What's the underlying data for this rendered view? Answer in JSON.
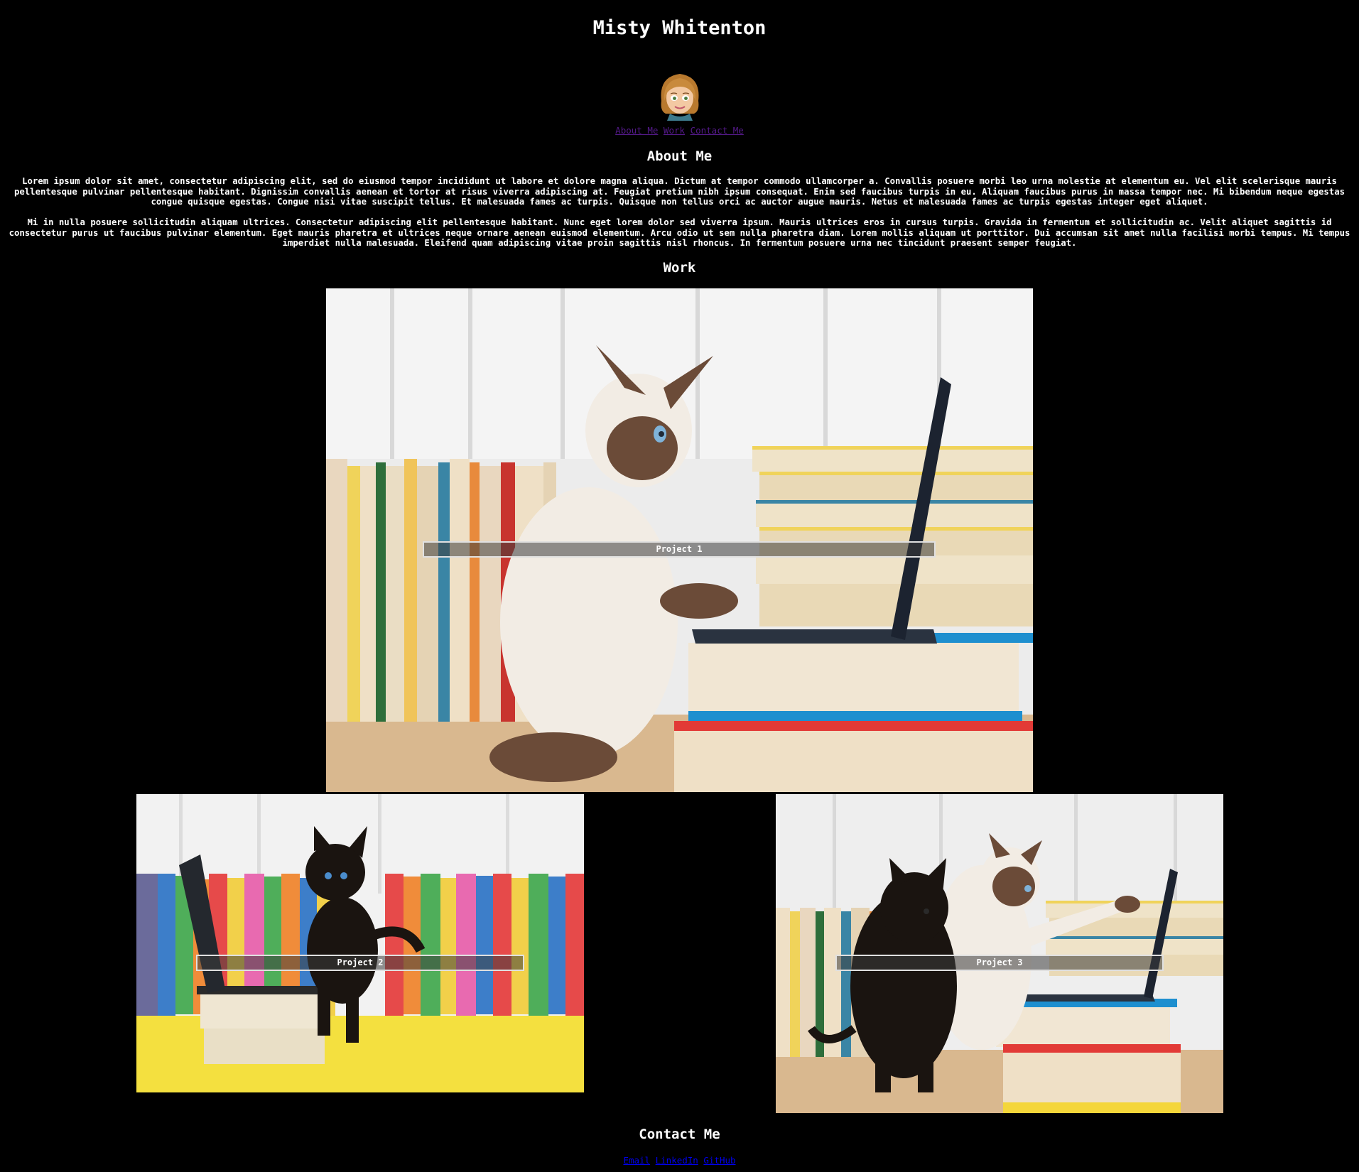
{
  "site": {
    "title": "Misty Whitenton",
    "avatar_icon": "bitmoji-avatar-icon"
  },
  "nav": {
    "items": [
      "About Me",
      "Work",
      "Contact Me"
    ]
  },
  "about": {
    "heading": "About Me",
    "paragraphs": [
      "Lorem ipsum dolor sit amet, consectetur adipiscing elit, sed do eiusmod tempor incididunt ut labore et dolore magna aliqua. Dictum at tempor commodo ullamcorper a. Convallis posuere morbi leo urna molestie at elementum eu. Vel elit scelerisque mauris pellentesque pulvinar pellentesque habitant. Dignissim convallis aenean et tortor at risus viverra adipiscing at. Feugiat pretium nibh ipsum consequat. Enim sed faucibus turpis in eu. Aliquam faucibus purus in massa tempor nec. Mi bibendum neque egestas congue quisque egestas. Congue nisi vitae suscipit tellus. Et malesuada fames ac turpis. Quisque non tellus orci ac auctor augue mauris. Netus et malesuada fames ac turpis egestas integer eget aliquet.",
      "Mi in nulla posuere sollicitudin aliquam ultrices. Consectetur adipiscing elit pellentesque habitant. Nunc eget lorem dolor sed viverra ipsum. Mauris ultrices eros in cursus turpis. Gravida in fermentum et sollicitudin ac. Velit aliquet sagittis id consectetur purus ut faucibus pulvinar elementum. Eget mauris pharetra et ultrices neque ornare aenean euismod elementum. Arcu odio ut sem nulla pharetra diam. Lorem mollis aliquam ut porttitor. Dui accumsan sit amet nulla facilisi morbi tempus. Mi tempus imperdiet nulla malesuada. Eleifend quam adipiscing vitae proin sagittis nisl rhoncus. In fermentum posuere urna nec tincidunt praesent semper feugiat."
    ]
  },
  "work": {
    "heading": "Work",
    "projects": [
      {
        "label": "Project 1"
      },
      {
        "label": "Project 2"
      },
      {
        "label": "Project 3"
      }
    ]
  },
  "contact": {
    "heading": "Contact Me",
    "links": [
      "Email",
      "LinkedIn",
      "GitHub"
    ]
  },
  "colors": {
    "background": "#000000",
    "text": "#ffffff",
    "visited_link": "#551a8b",
    "link": "#0000ee"
  }
}
